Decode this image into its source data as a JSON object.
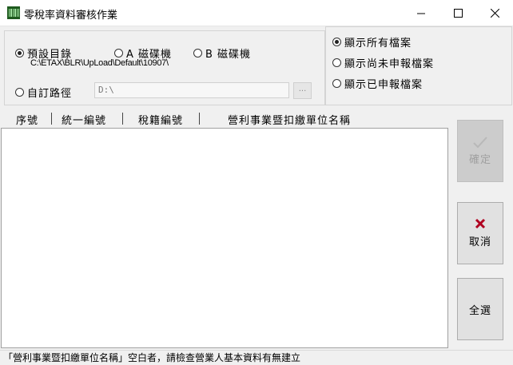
{
  "window": {
    "title": "零稅率資料審核作業",
    "icon": "barcode-app-icon"
  },
  "source": {
    "option_default": "預設目錄",
    "option_a": "A 磁碟機",
    "option_b": "B 磁碟機",
    "default_path": "C:\\ETAX\\BLR\\UpLoad\\Default\\10907\\",
    "option_custom": "自訂路徑",
    "custom_path_value": "D:\\",
    "browse_label": "...",
    "selected": "default"
  },
  "filter": {
    "option_all": "顯示所有檔案",
    "option_unreported": "顯示尚未申報檔案",
    "option_reported": "顯示已申報檔案",
    "selected": "all"
  },
  "table": {
    "columns": [
      "序號",
      "統一編號",
      "稅籍編號",
      "營利事業暨扣繳單位名稱"
    ],
    "rows": []
  },
  "buttons": {
    "confirm": "確定",
    "cancel": "取消",
    "select_all": "全選"
  },
  "status": {
    "message": "「營利事業暨扣繳單位名稱」空白者，請檢查營業人基本資料有無建立"
  },
  "colors": {
    "cancel_icon": "#b00020",
    "disabled_text": "#a0a0a0"
  }
}
